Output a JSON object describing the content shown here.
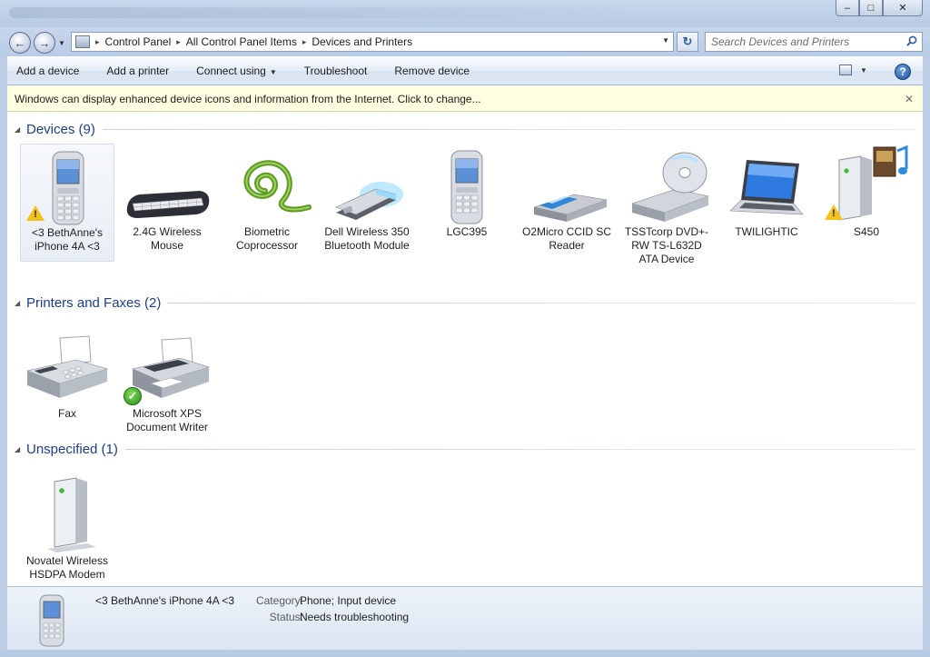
{
  "window": {
    "min_glyph": "–",
    "max_glyph": "□",
    "close_glyph": "✕"
  },
  "address": {
    "back_glyph": "←",
    "forward_glyph": "→",
    "breadcrumbs": [
      "Control Panel",
      "All Control Panel Items",
      "Devices and Printers"
    ],
    "separator": "▸",
    "refresh_glyph": "↻",
    "search_placeholder": "Search Devices and Printers"
  },
  "toolbar": {
    "add_device": "Add a device",
    "add_printer": "Add a printer",
    "connect_using": "Connect using",
    "troubleshoot": "Troubleshoot",
    "remove_device": "Remove device",
    "help_glyph": "?",
    "dropdown_glyph": "▼"
  },
  "infobar": {
    "text": "Windows can display enhanced device icons and information from the Internet. Click to change...",
    "close_glyph": "✕"
  },
  "groups": {
    "devices": {
      "title": "Devices (9)",
      "items": [
        {
          "label": "<3 BethAnne's iPhone 4A <3",
          "icon": "phone-icon",
          "warning": true,
          "selected": true
        },
        {
          "label": "2.4G Wireless Mouse",
          "icon": "keyboard-icon"
        },
        {
          "label": "Biometric Coprocessor",
          "icon": "biometric-swirl-icon"
        },
        {
          "label": "Dell Wireless 350 Bluetooth Module",
          "icon": "bluetooth-usb-icon"
        },
        {
          "label": "LGC395",
          "icon": "phone-icon"
        },
        {
          "label": "O2Micro CCID SC Reader",
          "icon": "card-reader-icon"
        },
        {
          "label": "TSSTcorp DVD+-RW TS-L632D ATA Device",
          "icon": "dvd-drive-icon"
        },
        {
          "label": "TWILIGHTIC",
          "icon": "laptop-icon"
        },
        {
          "label": "S450",
          "icon": "media-device-icon",
          "warning": true
        }
      ]
    },
    "printers": {
      "title": "Printers and Faxes (2)",
      "items": [
        {
          "label": "Fax",
          "icon": "fax-icon"
        },
        {
          "label": "Microsoft XPS Document Writer",
          "icon": "printer-icon",
          "default": true
        }
      ]
    },
    "unspecified": {
      "title": "Unspecified (1)",
      "items": [
        {
          "label": "Novatel Wireless HSDPA Modem",
          "icon": "modem-tower-icon"
        }
      ]
    }
  },
  "details": {
    "name": "<3 BethAnne's iPhone 4A <3",
    "category_label": "Category:",
    "category_value": "Phone; Input device",
    "status_label": "Status:",
    "status_value": "Needs troubleshooting"
  },
  "colors": {
    "accent": "#1e3d8f",
    "infobar_bg": "#ffffe1",
    "warning": "#f3c11c",
    "ok": "#2a8e18"
  }
}
